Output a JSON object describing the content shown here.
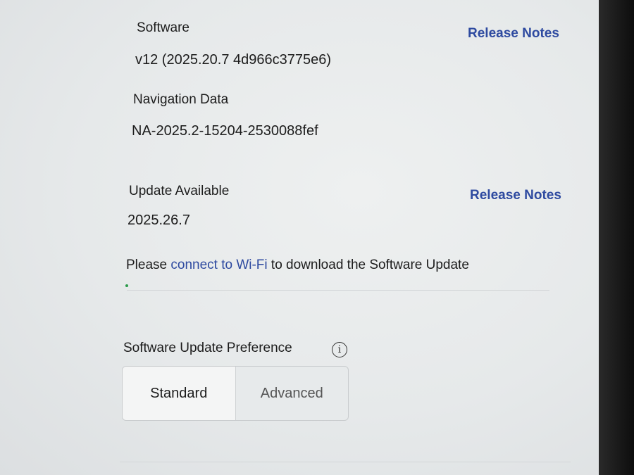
{
  "software": {
    "label": "Software",
    "version": "v12 (2025.20.7 4d966c3775e6)",
    "release_notes": "Release Notes"
  },
  "navigation": {
    "label": "Navigation Data",
    "version": "NA-2025.2-15204-2530088fef"
  },
  "update": {
    "label": "Update Available",
    "version": "2025.26.7",
    "release_notes": "Release Notes",
    "message_prefix": "Please ",
    "message_link": "connect to Wi-Fi",
    "message_suffix": " to download the Software Update"
  },
  "preference": {
    "label": "Software Update Preference",
    "info_icon": "i",
    "options": [
      "Standard",
      "Advanced"
    ],
    "selected": "Standard"
  }
}
